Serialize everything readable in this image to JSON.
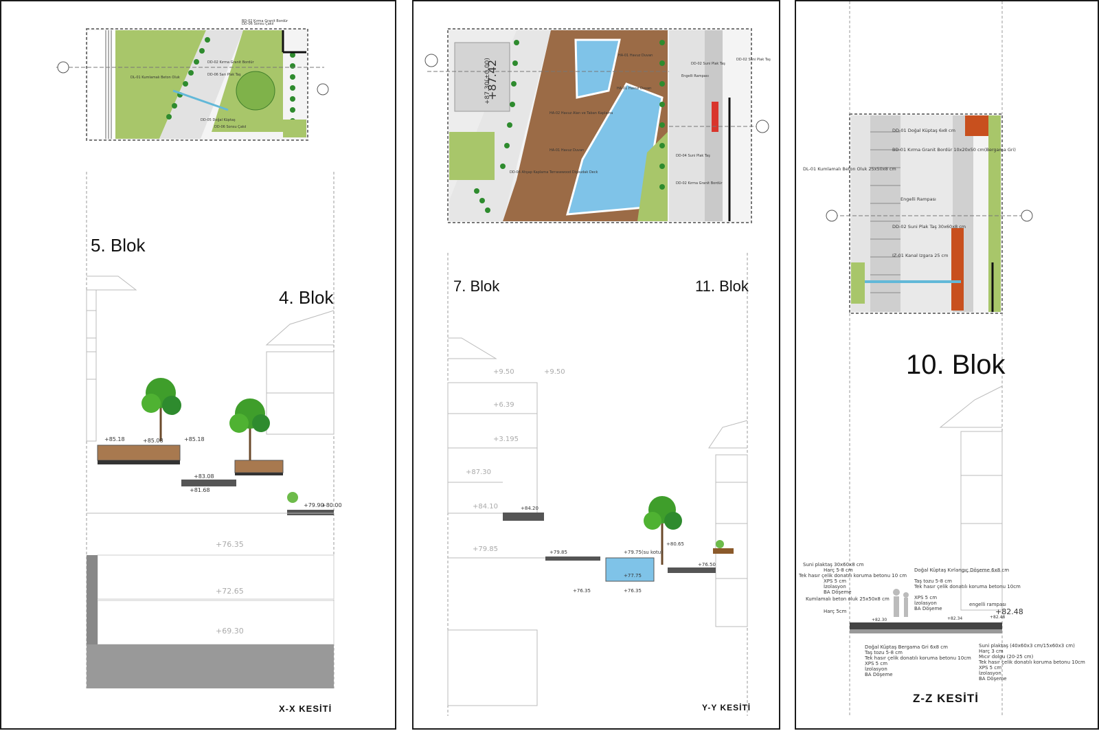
{
  "sheets": [
    {
      "id": "xx",
      "title": "X-X KESİTİ",
      "blocks": [
        "5. Blok",
        "4. Blok"
      ],
      "plan_labels": [
        "BD-02 Kırma Granit Bordür",
        "DD-06 Sarı Plak Taş",
        "DD-02 Kırma Granit Bordür",
        "DL-01 Kumlamalı Beton Oluk",
        "DD-05 Doğal Küptaş",
        "DD-06 Sonsu Çakıl",
        "DD-06 Sonsu Çakıl"
      ],
      "spot_levels": [
        "+85.18",
        "+85.08",
        "+85.18",
        "+83.08",
        "+81.68",
        "+79.90",
        "+80.00"
      ],
      "floor_levels": [
        "+76.35",
        "+72.65",
        "+69.30"
      ]
    },
    {
      "id": "yy",
      "title": "Y-Y KESİTİ",
      "blocks": [
        "7. Blok",
        "11. Blok"
      ],
      "plan_labels": [
        "HA-01 Havuz Duvarı",
        "HA-01 Havuz Duvarı",
        "HA-02 Havuz Alan ve Taban Kaplama",
        "HA-01 Havuz Duvarı",
        "DD-06 Ahşap Kaplama Terrasewood Dişbudak Deck",
        "DD-02 Suni Plak Taş",
        "DD-02 Suni Plak Taş",
        "DD-04 Suni Plak Taş",
        "DD-02 Kırma Granit Bordür",
        "Engelli Rampası"
      ],
      "plan_level_labels": [
        "+87.42",
        "+87.30(±0.00)"
      ],
      "floor_levels": [
        "+9.50",
        "+9.50",
        "+6.39",
        "+3.195",
        "+87.30",
        "+84.10",
        "+79.85"
      ],
      "spot_levels": [
        "+84.20",
        "+79.85",
        "+79.75(su kotu)",
        "+80.65",
        "+76.35",
        "+77.75",
        "+76.35",
        "+76.50"
      ]
    },
    {
      "id": "zz",
      "title": "Z-Z KESİTİ",
      "blocks": [
        "10. Blok"
      ],
      "plan_labels": [
        "DD-01 Doğal Küptaş 6x8 cm",
        "BD-01 Kırma Granit Bordür 10x20x50 cm(Bergama Gri)",
        "DL-01 Kumlamalı Beton Oluk 25x50x8 cm",
        "Engelli Rampası",
        "DD-02 Suni Plak Taş 30x60x8 cm",
        "IZ-01 Kanal Izgara 25 cm"
      ],
      "notes_left": [
        "Suni plaktaş 30x60x8 cm",
        "Harç 5-8 cm",
        "Tek hasır çelik donatılı koruma betonu 10 cm",
        "XPS 5 cm",
        "İzolasyon",
        "BA Döşeme",
        "Kumlamalı beton oluk 25x50x8 cm",
        "Harç 5cm"
      ],
      "notes_mid": [
        "Doğal Küptaş Kırlangıç Döşeme 6x8 cm",
        "Taş tozu 5-8 cm",
        "Tek hasır çelik donatılı koruma betonu 10cm",
        "XPS 5 cm",
        "İzolasyon",
        "BA Döşeme",
        "engelli rampası"
      ],
      "notes_bottom_left": [
        "Doğal Küptaş Bergama Gri 6x8 cm",
        "Taş tozu 5-8 cm",
        "Tek hasır çelik donatılı koruma betonu 10cm",
        "XPS 5 cm",
        "İzolasyon",
        "BA Döşeme"
      ],
      "notes_bottom_right": [
        "Suni plaktaş (40x60x3 cm/15x60x3 cm)",
        "Harç 3 cm",
        "Mıcır dolgu (20-25 cm)",
        "Tek hasır çelik donatılı koruma betonu 10cm",
        "XPS 5 cm",
        "İzolasyon",
        "BA Döşeme"
      ],
      "spot_levels": [
        "+82.48",
        "+82.30",
        "+82.34",
        "+82.48"
      ]
    }
  ],
  "colors": {
    "grass": "#a8c66a",
    "deck": "#9b6b46",
    "pool": "#7fc3e8",
    "tree": "#3f9e2b",
    "paving": "#d9d9d9",
    "hedge": "#2e8b2e",
    "flowers": "#c8501e",
    "border": "#1a1a1a"
  }
}
